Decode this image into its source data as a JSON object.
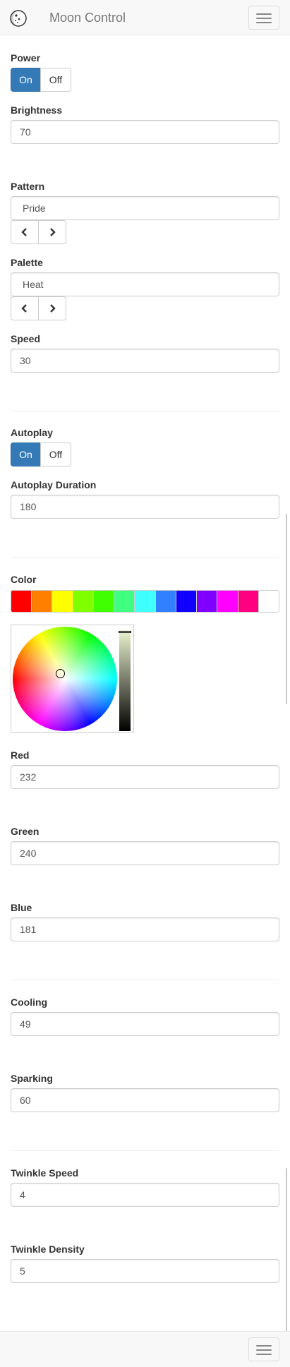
{
  "app": {
    "title": "Moon Control"
  },
  "power": {
    "label": "Power",
    "on": "On",
    "off": "Off",
    "selected": "On"
  },
  "brightness": {
    "label": "Brightness",
    "value": "70"
  },
  "pattern": {
    "label": "Pattern",
    "value": "Pride",
    "prev": "previous",
    "next": "next"
  },
  "palette": {
    "label": "Palette",
    "value": "Heat"
  },
  "speed": {
    "label": "Speed",
    "value": "30"
  },
  "autoplay": {
    "label": "Autoplay",
    "on": "On",
    "off": "Off",
    "selected": "On"
  },
  "autoplay_duration": {
    "label": "Autoplay Duration",
    "value": "180"
  },
  "color": {
    "label": "Color",
    "swatches": [
      "#ff0000",
      "#ff8000",
      "#ffff00",
      "#80ff00",
      "#40ff00",
      "#40ff80",
      "#40ffff",
      "#3080ff",
      "#1000ff",
      "#8000ff",
      "#ff00ff",
      "#ff0080",
      "#ffffff"
    ],
    "selected_hex": "#e8f0b5"
  },
  "red": {
    "label": "Red",
    "value": "232"
  },
  "green": {
    "label": "Green",
    "value": "240"
  },
  "blue": {
    "label": "Blue",
    "value": "181"
  },
  "cooling": {
    "label": "Cooling",
    "value": "49"
  },
  "sparking": {
    "label": "Sparking",
    "value": "60"
  },
  "twinkle_speed": {
    "label": "Twinkle Speed",
    "value": "4"
  },
  "twinkle_density": {
    "label": "Twinkle Density",
    "value": "5"
  },
  "icons": {
    "prev": "chevron-left-icon",
    "next": "chevron-right-icon",
    "menu": "hamburger-menu-icon",
    "logo": "moon-logo-icon"
  }
}
